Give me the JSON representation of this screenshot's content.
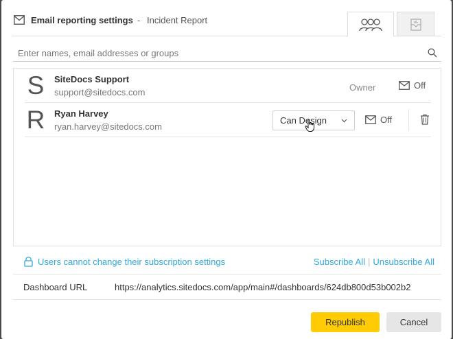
{
  "header": {
    "title": "Email reporting settings",
    "separator": "-",
    "subtitle": "Incident Report",
    "icon": "mail-icon"
  },
  "tabs": [
    {
      "name": "users",
      "icon": "users-icon",
      "active": true
    },
    {
      "name": "dashboard",
      "icon": "dashboard-icon",
      "active": false
    }
  ],
  "search": {
    "placeholder": "Enter names, email addresses or groups",
    "value": "",
    "icon": "search-icon"
  },
  "users": [
    {
      "initial": "S",
      "name": "SiteDocs Support",
      "email": "support@sitedocs.com",
      "role": "Owner",
      "email_subscription": "Off"
    },
    {
      "initial": "R",
      "name": "Ryan Harvey",
      "email": "ryan.harvey@sitedocs.com",
      "role": "Can Design",
      "email_subscription": "Off"
    }
  ],
  "subscription": {
    "lock_text": "Users cannot change their subscription settings",
    "subscribe_all": "Subscribe All",
    "unsubscribe_all": "Unsubscribe All"
  },
  "dashboard_url": {
    "label": "Dashboard URL",
    "value": "https://analytics.sitedocs.com/app/main#/dashboards/624db800d53b002b2"
  },
  "footer": {
    "republish_label": "Republish",
    "cancel_label": "Cancel"
  },
  "colors": {
    "accent": "#2eaadc",
    "primary_button": "#ffcb05",
    "secondary_button": "#e6e6e6"
  }
}
